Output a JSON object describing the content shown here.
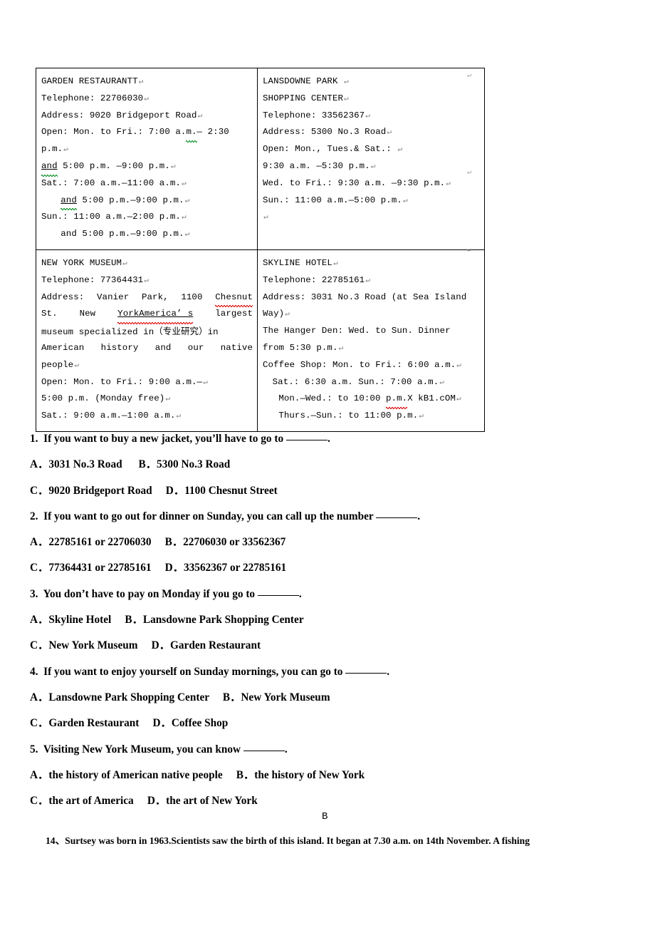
{
  "table": {
    "cells": [
      {
        "id": "garden-restaurant",
        "title": "GARDEN RESTAURANTT",
        "lines": [
          "Telephone: 22706030",
          "Address: 9020 Bridgeport Road",
          "Open: Mon. to Fri.: 7:00 a.m.— 2:30",
          "p.m.",
          "and 5:00 p.m. —9:00 p.m.",
          "Sat.: 7:00 a.m.—11:00 a.m.",
          "and 5:00 p.m.—9:00 p.m.",
          "Sun.: 11:00 a.m.—2:00 p.m.",
          "and 5:00 p.m.—9:00 p.m."
        ]
      },
      {
        "id": "lansdowne-park-shopping-center",
        "title": "LANSDOWNE PARK",
        "subtitle": "SHOPPING CENTER",
        "lines": [
          "Telephone: 33562367",
          "Address: 5300 No.3 Road",
          "Open: Mon., Tues.& Sat.:",
          "9:30 a.m. —5:30 p.m.",
          "Wed. to Fri.: 9:30 a.m. —9:30 p.m.",
          "Sun.: 11:00 a.m.—5:00 p.m."
        ]
      },
      {
        "id": "new-york-museum",
        "title": "NEW YORK MUSEUM",
        "lines": [
          "Telephone: 77364431",
          "Address: Vanier Park, 1100 Chesnut",
          "St. New YorkAmerica’ s largest",
          "museum specialized in（专业研究）in",
          "American history and our native",
          "people",
          "Open: Mon. to Fri.: 9:00 a.m.—",
          "5:00 p.m. (Monday free)",
          "Sat.: 9:00 a.m.—1:00 a.m."
        ],
        "address_part1": "Address: Vanier Park, 1100 ",
        "address_misspelled": "Chesnut",
        "address_part2": "St.  New  ",
        "address_misspelled2": "YorkAmerica",
        "address_part3": "’ s",
        "address_part4": "largest",
        "desc_part1": "museum specialized in（",
        "desc_cjk": "专业研究",
        "desc_part2": "）in",
        "desc_line3": "American  history  and  our  native",
        "desc_line4": "people"
      },
      {
        "id": "skyline-hotel",
        "title": "SKYLINE HOTEL",
        "lines": [
          "Telephone: 22785161",
          "Address: 3031 No.3 Road (at Sea Island",
          "Way)",
          "The Hanger Den: Wed. to Sun. Dinner",
          "from 5:30 p.m.",
          "Coffee Shop: Mon. to Fri.: 6:00 a.m.",
          "Sat.: 6:30 a.m. Sun.: 7:00 a.m.",
          "Mon.—Wed.: to 10:00 p.m.X kB1.cOM",
          "Thurs.—Sun.: to 11:00 p.m."
        ],
        "watermark_clean": "p.m.",
        "watermark": "X kB1.cOM"
      }
    ]
  },
  "questions": [
    {
      "number": "1.",
      "stem_before": "If you want to buy a new jacket, you’ll have to go to ",
      "stem_after": ".",
      "options_row1": "A．3031 No.3 Road      B．5300 No.3 Road",
      "options_row2": "C．9020 Bridgeport Road     D．1100 Chesnut Street"
    },
    {
      "number": "2.",
      "stem_before": "If you want to go out for dinner on Sunday, you can call up the number ",
      "stem_after": ".",
      "options_row1": "A．22785161 or 22706030     B．22706030 or 33562367",
      "options_row2": "C．77364431 or 22785161     D．33562367 or 22785161"
    },
    {
      "number": "3.",
      "stem_before": "You don’t have to pay on Monday if you go to ",
      "stem_after": ".",
      "options_row1": "A．Skyline Hotel     B．Lansdowne Park Shopping Center",
      "options_row2": "C．New York Museum     D．Garden Restaurant"
    },
    {
      "number": "4.",
      "stem_before": "If you want to enjoy yourself on Sunday mornings, you can go to ",
      "stem_after": ".",
      "options_row1": "A．Lansdowne Park Shopping Center     B．New York Museum",
      "options_row2": "C．Garden Restaurant     D．Coffee Shop"
    },
    {
      "number": "5.",
      "stem_before": "Visiting New York Museum, you can know ",
      "stem_after": ".",
      "options_row1": "A．the history of American native people     B．the history of New York",
      "options_row2": "C．the art of America     D．the art of New York"
    }
  ],
  "answer_mark": "B",
  "footer_paragraph": "14、Surtsey was born in 1963.Scientists saw the birth of this island. It began at 7.30 a.m. on 14th November. A fishing",
  "colors": {
    "text": "#000000",
    "border": "#000000",
    "spellcheck_red": "#e02020",
    "grammar_green": "#1f9b39",
    "pilcrow_gray": "#7e7e7e"
  }
}
